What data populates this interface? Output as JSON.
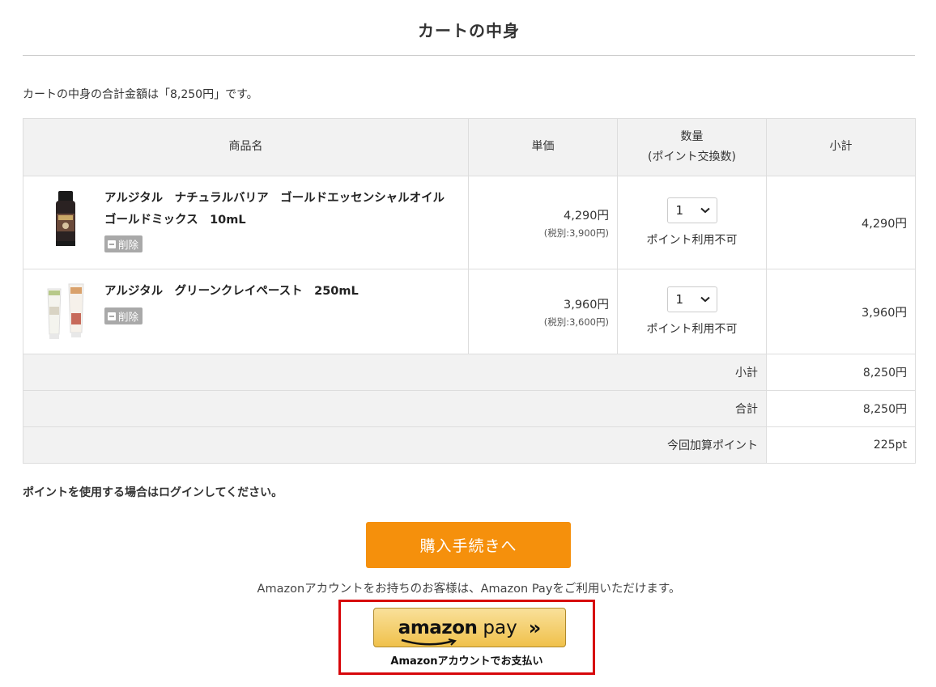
{
  "page": {
    "title": "カートの中身",
    "summary": "カートの中身の合計金額は「8,250円」です。"
  },
  "table": {
    "headers": {
      "name": "商品名",
      "price": "単価",
      "qty_line1": "数量",
      "qty_line2": "(ポイント交換数)",
      "subtotal": "小計"
    },
    "items": [
      {
        "name": "アルジタル　ナチュラルバリア　ゴールドエッセンシャルオイル　ゴールドミックス　10mL",
        "delete_label": "削除",
        "price": "4,290円",
        "price_tax": "(税別:3,900円)",
        "qty": "1",
        "qty_note": "ポイント利用不可",
        "subtotal": "4,290円"
      },
      {
        "name": "アルジタル　グリーンクレイペースト　250mL",
        "delete_label": "削除",
        "price": "3,960円",
        "price_tax": "(税別:3,600円)",
        "qty": "1",
        "qty_note": "ポイント利用不可",
        "subtotal": "3,960円"
      }
    ],
    "totals": [
      {
        "label": "小計",
        "value": "8,250円"
      },
      {
        "label": "合計",
        "value": "8,250円"
      },
      {
        "label": "今回加算ポイント",
        "value": "225pt"
      }
    ]
  },
  "login_note": "ポイントを使用する場合はログインしてください。",
  "checkout_button": "購入手続きへ",
  "amazon": {
    "note": "Amazonアカウントをお持ちのお客様は、Amazon Payをご利用いただけます。",
    "logo_amazon": "amazon",
    "logo_pay": "pay",
    "chevrons": "»",
    "caption": "Amazonアカウントでお支払い",
    "highlight_color": "#d7070b"
  },
  "colors": {
    "checkout": "#f5900c",
    "header_bg": "#f2f2f2",
    "delete_bg": "#a9a9a9"
  }
}
